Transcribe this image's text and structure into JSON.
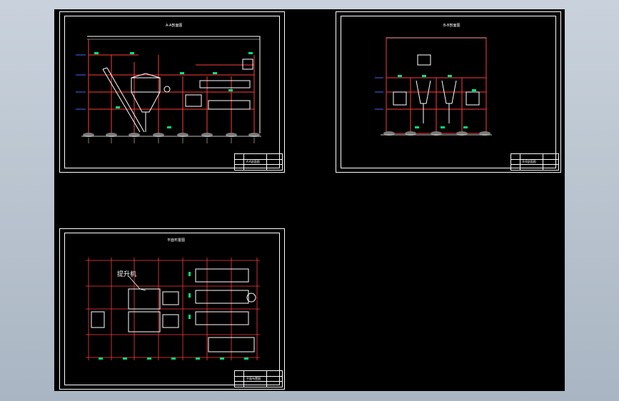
{
  "sheets": {
    "elevation_a": {
      "title": "A-A剖面图"
    },
    "elevation_b": {
      "title": "B-B剖面图"
    },
    "plan": {
      "title": "平面布置图",
      "callout": "提升机"
    }
  },
  "colors": {
    "background": "#000000",
    "frame": "#ffffff",
    "structure": "#ff3b3b",
    "equipment": "#ffffff",
    "dimension": "#00e676",
    "elevation_mark": "#4169ff"
  }
}
